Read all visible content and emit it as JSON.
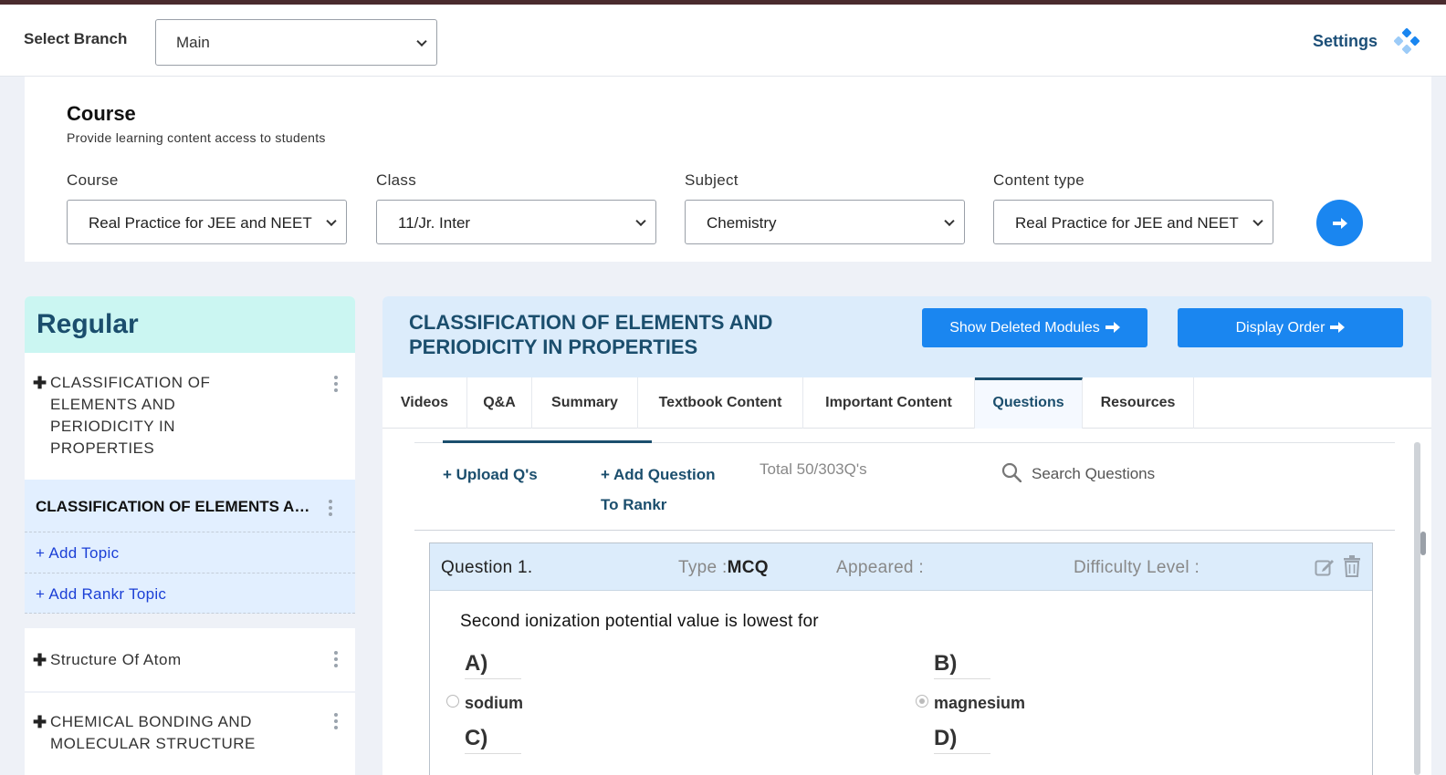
{
  "header": {
    "branch_label": "Select Branch",
    "branch_value": "Main",
    "settings_label": "Settings"
  },
  "course": {
    "title": "Course",
    "subtitle": "Provide learning content access to students",
    "fields": [
      {
        "label": "Course",
        "value": "Real Practice for JEE and NEET"
      },
      {
        "label": "Class",
        "value": "11/Jr. Inter"
      },
      {
        "label": "Subject",
        "value": "Chemistry"
      },
      {
        "label": "Content type",
        "value": "Real Practice for JEE and NEET"
      }
    ]
  },
  "sidebar": {
    "title": "Regular",
    "items": [
      {
        "label": "CLASSIFICATION OF ELEMENTS AND PERIODICITY IN PROPERTIES"
      },
      {
        "label": "Structure Of Atom"
      },
      {
        "label": "CHEMICAL BONDING AND MOLECULAR STRUCTURE"
      }
    ],
    "active_topic": "CLASSIFICATION OF ELEMENTS AND PERIODICITY IN PROPERTIES",
    "add_topic": "+ Add Topic",
    "add_rankr_topic": "+ Add Rankr Topic"
  },
  "module": {
    "title": "CLASSIFICATION OF ELEMENTS AND PERIODICITY IN PROPERTIES",
    "show_deleted_label": "Show Deleted Modules",
    "display_order_label": "Display Order"
  },
  "tabs": [
    "Videos",
    "Q&A",
    "Summary",
    "Textbook Content",
    "Important Content",
    "Questions",
    "Resources"
  ],
  "active_tab": "Questions",
  "questions": {
    "upload_label": "+ Upload Q's",
    "add_question_line1": "+ Add Question",
    "add_question_line2": "To Rankr",
    "total_label": "Total 50/303Q's",
    "search_placeholder": "Search Questions"
  },
  "question": {
    "number_label": "Question 1.",
    "type_label": "Type :",
    "type_value": "MCQ",
    "appeared_label": "Appeared :",
    "difficulty_label": "Difficulty Level :",
    "text": "Second ionization potential value is lowest for",
    "options": [
      {
        "letter": "A)",
        "text": "sodium",
        "selected": false
      },
      {
        "letter": "B)",
        "text": "magnesium",
        "selected": true
      },
      {
        "letter": "C)",
        "text": "",
        "selected": false
      },
      {
        "letter": "D)",
        "text": "",
        "selected": false
      }
    ]
  },
  "colors": {
    "accent": "#1a86f0",
    "navy": "#1b4e6d",
    "sidebar_head": "#cbf6f2",
    "active_bg": "#e2efff",
    "link": "#1b3fd6"
  }
}
